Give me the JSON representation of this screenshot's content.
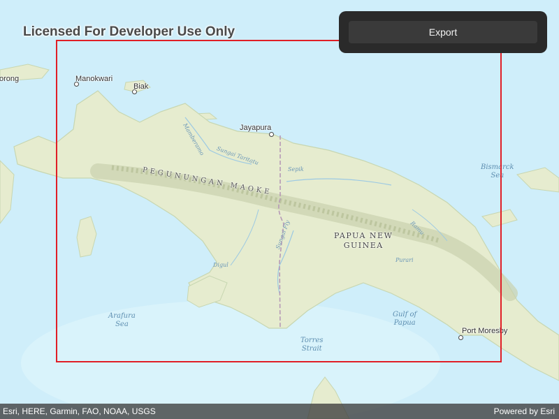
{
  "watermark": "Licensed For Developer Use Only",
  "export_panel": {
    "button_label": "Export"
  },
  "attribution": {
    "text": "Esri, HERE, Garmin, FAO, NOAA, USGS",
    "powered_by": "Powered by Esri"
  },
  "map": {
    "places": {
      "manokwari": "Manokwari",
      "biak": "Biak",
      "sorong": "orong",
      "jayapura": "Jayapura",
      "port_moresby": "Port Moresby"
    },
    "water": {
      "arafura_sea": "Arafura\nSea",
      "gulf_of_papua": "Gulf of\nPapua",
      "torres_strait": "Torres\nStrait",
      "bismarck_sea": "Bismarck\nSea"
    },
    "rivers": {
      "mamberamo": "Mamberamo",
      "sungai_taritatu": "Sungai Taritatu",
      "sepik": "Sepik",
      "sungai_fly": "Sungai Fly",
      "digul": "Digul",
      "ramu": "Ramu",
      "purari": "Purari"
    },
    "range": "PEGUNUNGAN MAOKE",
    "country": "PAPUA NEW\nGUINEA"
  },
  "colors": {
    "extent_outline": "#e01e26",
    "panel": "#2a2a2a",
    "button": "#3a3a3a",
    "land": "#e6eccf",
    "water": "#cfeefa"
  }
}
